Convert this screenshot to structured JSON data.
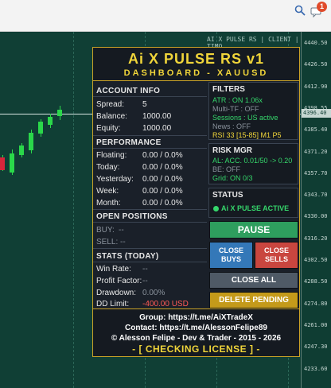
{
  "topbar": {
    "notif_count": "1"
  },
  "chart": {
    "label": "AI X PULSE RS | CLIENT | TIMO",
    "price_tag": "4396.40",
    "ticks": [
      "4440.50",
      "4426.50",
      "4412.90",
      "4398.55",
      "4385.40",
      "4371.20",
      "4357.70",
      "4343.70",
      "4330.00",
      "4316.20",
      "4302.50",
      "4288.50",
      "4274.80",
      "4261.00",
      "4247.30",
      "4233.60",
      "4219.30"
    ]
  },
  "header": {
    "title": "Ai X PULSE RS v1",
    "subtitle": "DASHBOARD - XAUUSD"
  },
  "account": {
    "title": "ACCOUNT INFO",
    "spread_label": "Spread:",
    "spread": "5",
    "balance_label": "Balance:",
    "balance": "1000.00",
    "equity_label": "Equity:",
    "equity": "1000.00"
  },
  "performance": {
    "title": "PERFORMANCE",
    "rows": [
      {
        "label": "Floating:",
        "value": "0.00 / 0.0%"
      },
      {
        "label": "Today:",
        "value": "0.00 / 0.0%"
      },
      {
        "label": "Yesterday:",
        "value": "0.00 / 0.0%"
      },
      {
        "label": "Week:",
        "value": "0.00 / 0.0%"
      },
      {
        "label": "Month:",
        "value": "0.00 / 0.0%"
      }
    ]
  },
  "positions": {
    "title": "OPEN POSITIONS",
    "buy_label": "BUY:",
    "buy": "--",
    "sell_label": "SELL:",
    "sell": "--"
  },
  "stats": {
    "title": "STATS (TODAY)",
    "winrate_label": "Win Rate:",
    "winrate": "--",
    "pf_label": "Profit Factor:",
    "pf": "--",
    "dd_label": "Drawdown:",
    "dd": "0.00%",
    "ddlimit_label": "DD Limit:",
    "ddlimit": "-400.00 USD"
  },
  "filters": {
    "title": "FILTERS",
    "atr": "ATR : ON 1.06x",
    "mtf": "Multi-TF : OFF",
    "sessions": "Sessions : US active",
    "news": "News : OFF",
    "rsi": "RSI 33 [15-85] M1 P5"
  },
  "risk": {
    "title": "RISK MGR",
    "al": "AL: ACC. 0.01/50 -> 0.20",
    "be": "BE: OFF",
    "grid": "Grid: ON 0/3"
  },
  "status": {
    "title": "STATUS",
    "value": "Ai X PULSE ACTIVE"
  },
  "buttons": {
    "pause": "PAUSE",
    "close_buys": "CLOSE BUYS",
    "close_sells": "CLOSE SELLS",
    "close_all": "CLOSE ALL",
    "delete_pending": "DELETE PENDING"
  },
  "footer": {
    "group": "Group: https://t.me/AiXTradeX",
    "contact": "Contact: https://t.me/AlessonFelipe89",
    "copyright": "© Alesson Felipe - Dev & Trader - 2015 - 2026",
    "license": "- [ CHECKING LICENSE ] -"
  },
  "colors": {
    "accent": "#f0d53a",
    "green": "#2e9e5e",
    "blue": "#3478b8",
    "red": "#c9463f",
    "gray": "#4f5a66",
    "gold": "#c49a1a",
    "chart_bg": "#103f35"
  }
}
